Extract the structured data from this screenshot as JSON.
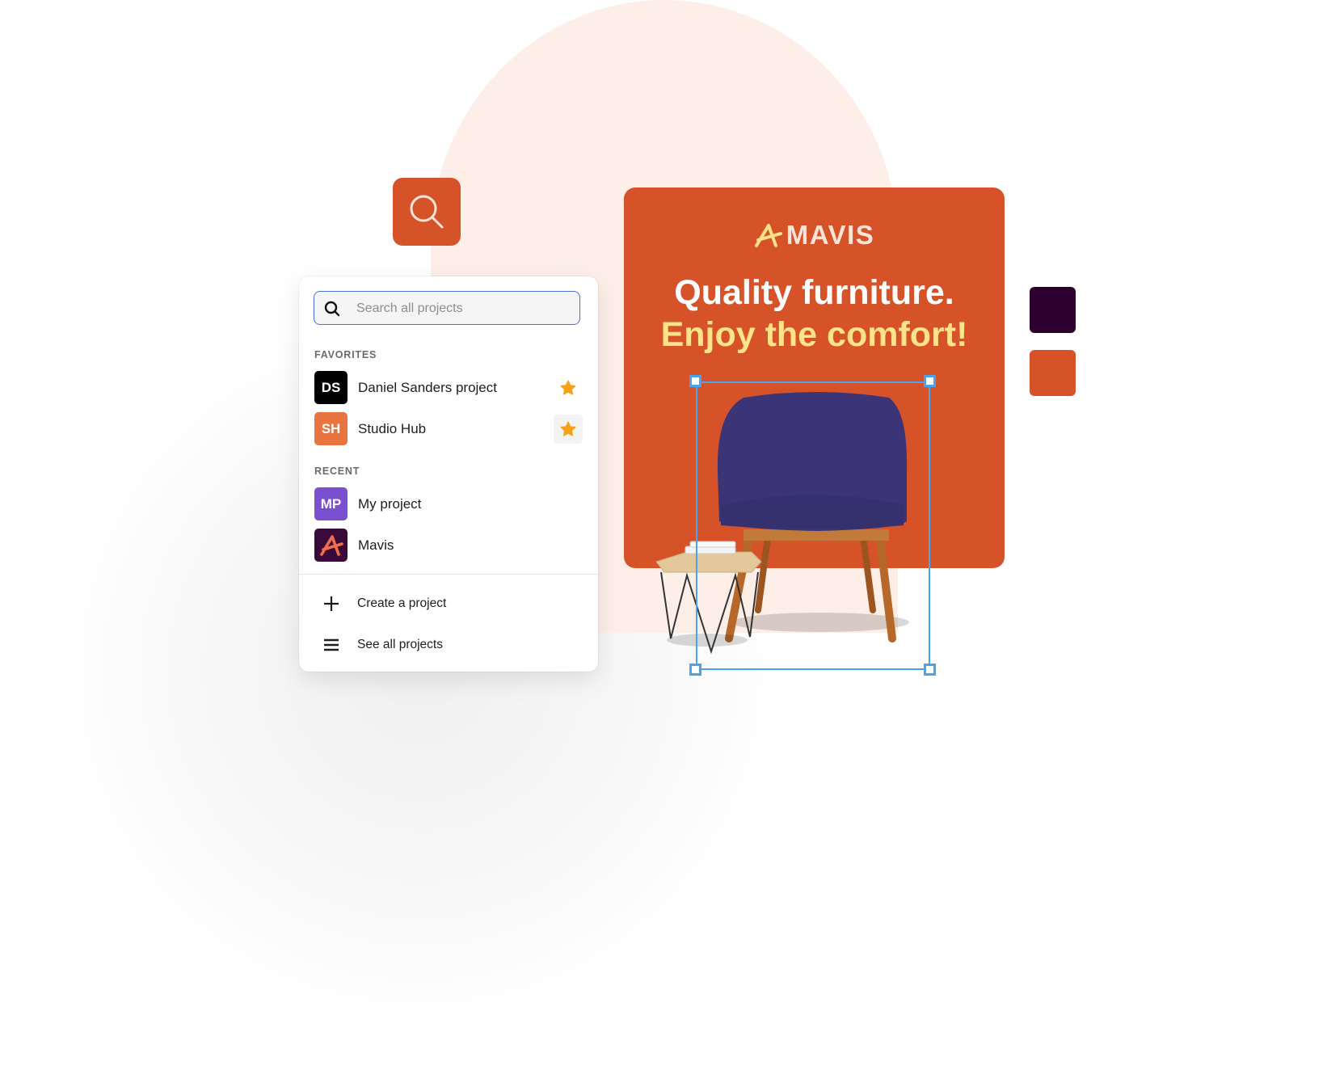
{
  "search_tile": {
    "icon": "search-icon",
    "color": "#d6532a"
  },
  "panel": {
    "search": {
      "placeholder": "Search all projects",
      "value": ""
    },
    "favorites": {
      "label": "FAVORITES",
      "items": [
        {
          "initials": "DS",
          "name": "Daniel Sanders project",
          "avatar_color": "#000000",
          "starred": true
        },
        {
          "initials": "SH",
          "name": "Studio Hub",
          "avatar_color": "#e8743f",
          "starred": true
        }
      ]
    },
    "recent": {
      "label": "RECENT",
      "items": [
        {
          "initials": "MP",
          "name": "My project",
          "avatar_color": "#7a4fd0"
        },
        {
          "initials": "",
          "name": "Mavis",
          "avatar_color": "#3a0a3a",
          "icon": "mavis-logo-icon"
        }
      ]
    },
    "actions": [
      {
        "icon": "plus-icon",
        "label": "Create a project"
      },
      {
        "icon": "list-icon",
        "label": "See all projects"
      }
    ]
  },
  "ad": {
    "brand": "MAVIS",
    "headline_line1": "Quality furniture.",
    "headline_line2": "Enjoy the comfort!",
    "background": "#d6532a",
    "accent": "#fde38a"
  },
  "swatches": [
    {
      "name": "dark-plum",
      "color": "#2e0030"
    },
    {
      "name": "orange",
      "color": "#d6532a"
    }
  ],
  "colors": {
    "selection": "#4aa3f0",
    "star": "#f7a11a",
    "arch": "#fdeee8"
  }
}
